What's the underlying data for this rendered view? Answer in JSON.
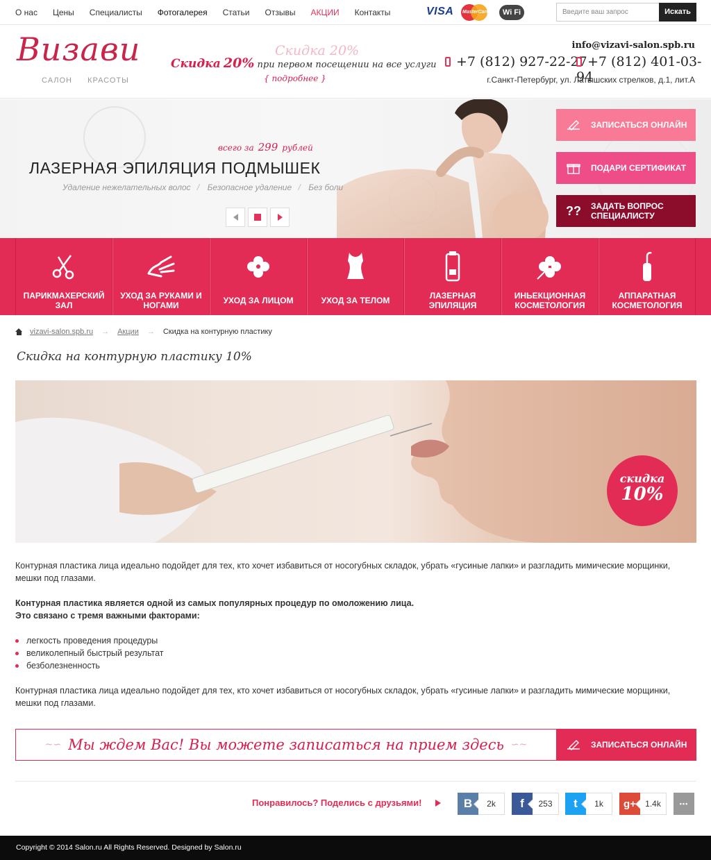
{
  "topnav": {
    "items": [
      {
        "label": "О нас"
      },
      {
        "label": "Цены"
      },
      {
        "label": "Специалисты"
      },
      {
        "label": "Фотогалерея"
      },
      {
        "label": "Статьи"
      },
      {
        "label": "Отзывы"
      },
      {
        "label": "АКЦИИ"
      },
      {
        "label": "Контакты"
      }
    ],
    "visa": "VISA",
    "mastercard": "MasterCard",
    "wifi": "Wi Fi",
    "search_placeholder": "Введите ваш запрос",
    "search_button": "Искать"
  },
  "header": {
    "logo_title": "Визави",
    "logo_sub1": "САЛОН",
    "logo_sub2": "КРАСОТЫ",
    "promo_word": "Скидка",
    "promo_percent": "20%",
    "promo_rest": "при первом посещении на все услуги",
    "promo_ghost": "Скидка 20%",
    "promo_more": "подробнее",
    "email": "info@vizavi-salon.spb.ru",
    "phone1": "+7 (812) 927-22-27",
    "phone2": "+7 (812) 401-03-94",
    "address": "г.Санкт-Петербург, ул. Латышских стрелков,  д.1, лит.А"
  },
  "hero": {
    "price_prefix": "всего за",
    "price_value": "299",
    "price_suffix": "рублей",
    "title": "ЛАЗЕРНАЯ ЭПИЛЯЦИЯ ПОДМЫШЕК",
    "sub1": "Удаление нежелательных волос",
    "sub2": "Безопасное удаление",
    "sub3": "Без боли",
    "sep": "/",
    "btn_online": "ЗАПИСАТЬСЯ ОНЛАЙН",
    "btn_gift": "ПОДАРИ СЕРТИФИКАТ",
    "btn_question": "ЗАДАТЬ ВОПРОС СПЕЦИАЛИСТУ",
    "colors": {
      "online": "#f97a96",
      "gift": "#ef4d88",
      "question": "#8c0c2c"
    }
  },
  "categories": [
    {
      "label": "ПАРИКМАХЕРСКИЙ ЗАЛ",
      "icon": "scissors-icon"
    },
    {
      "label": "УХОД ЗА РУКАМИ И НОГАМИ",
      "icon": "hand-icon"
    },
    {
      "label": "УХОД ЗА ЛИЦОМ",
      "icon": "flower-icon"
    },
    {
      "label": "УХОД ЗА ТЕЛОМ",
      "icon": "corset-icon"
    },
    {
      "label": "ЛАЗЕРНАЯ ЭПИЛЯЦИЯ",
      "icon": "laser-icon"
    },
    {
      "label": "ИНЬЕКЦИОННАЯ КОСМЕТОЛОГИЯ",
      "icon": "injection-flower-icon"
    },
    {
      "label": "АППАРАТНАЯ КОСМЕТОЛОГИЯ",
      "icon": "device-icon"
    }
  ],
  "breadcrumb": {
    "home": "vizavi-salon.spb.ru",
    "section": "Акции",
    "arrow": "→",
    "current": "Скидка на контурную пластику"
  },
  "page": {
    "title": "Скидка на контурную пластику 10%",
    "badge_word": "скидка",
    "badge_value": "10%",
    "para1": "Контурная пластика лица идеально подойдет для тех, кто хочет избавиться от носогубных складок, убрать «гусиные лапки» и разгладить мимические морщинки, мешки под глазами.",
    "bold1": "Контурная пластика является одной из самых популярных процедур по омоложению лица.",
    "bold2": "Это связано с тремя важными факторами:",
    "list": [
      "легкость проведения процедуры",
      "великолепный быстрый результат",
      "безболезненность"
    ],
    "para2": "Контурная пластика лица идеально подойдет для тех, кто хочет избавиться от носогубных складок, убрать «гусиные лапки» и разгладить мимические морщинки, мешки под глазами."
  },
  "cta": {
    "text": "Мы ждем Вас! Вы можете записаться на прием здесь",
    "button": "ЗАПИСАТЬСЯ ОНЛАЙН"
  },
  "share": {
    "label": "Понравилось? Поделись с друзьями!",
    "networks": [
      {
        "name": "vk",
        "glyph": "В",
        "count": "2k",
        "color": "#5b7fa6"
      },
      {
        "name": "facebook",
        "glyph": "f",
        "count": "253",
        "color": "#3b5998"
      },
      {
        "name": "twitter",
        "glyph": "t",
        "count": "1k",
        "color": "#1da1f2"
      },
      {
        "name": "google-plus",
        "glyph": "g+",
        "count": "1.4k",
        "color": "#dd4b39"
      }
    ],
    "more_glyph": "•••"
  },
  "footer": {
    "text": "Copyright © 2014 Salon.ru All Rights Reserved. Designed by Salon.ru"
  },
  "colors": {
    "accent": "#e22c55",
    "dark": "#0c0c0c"
  }
}
